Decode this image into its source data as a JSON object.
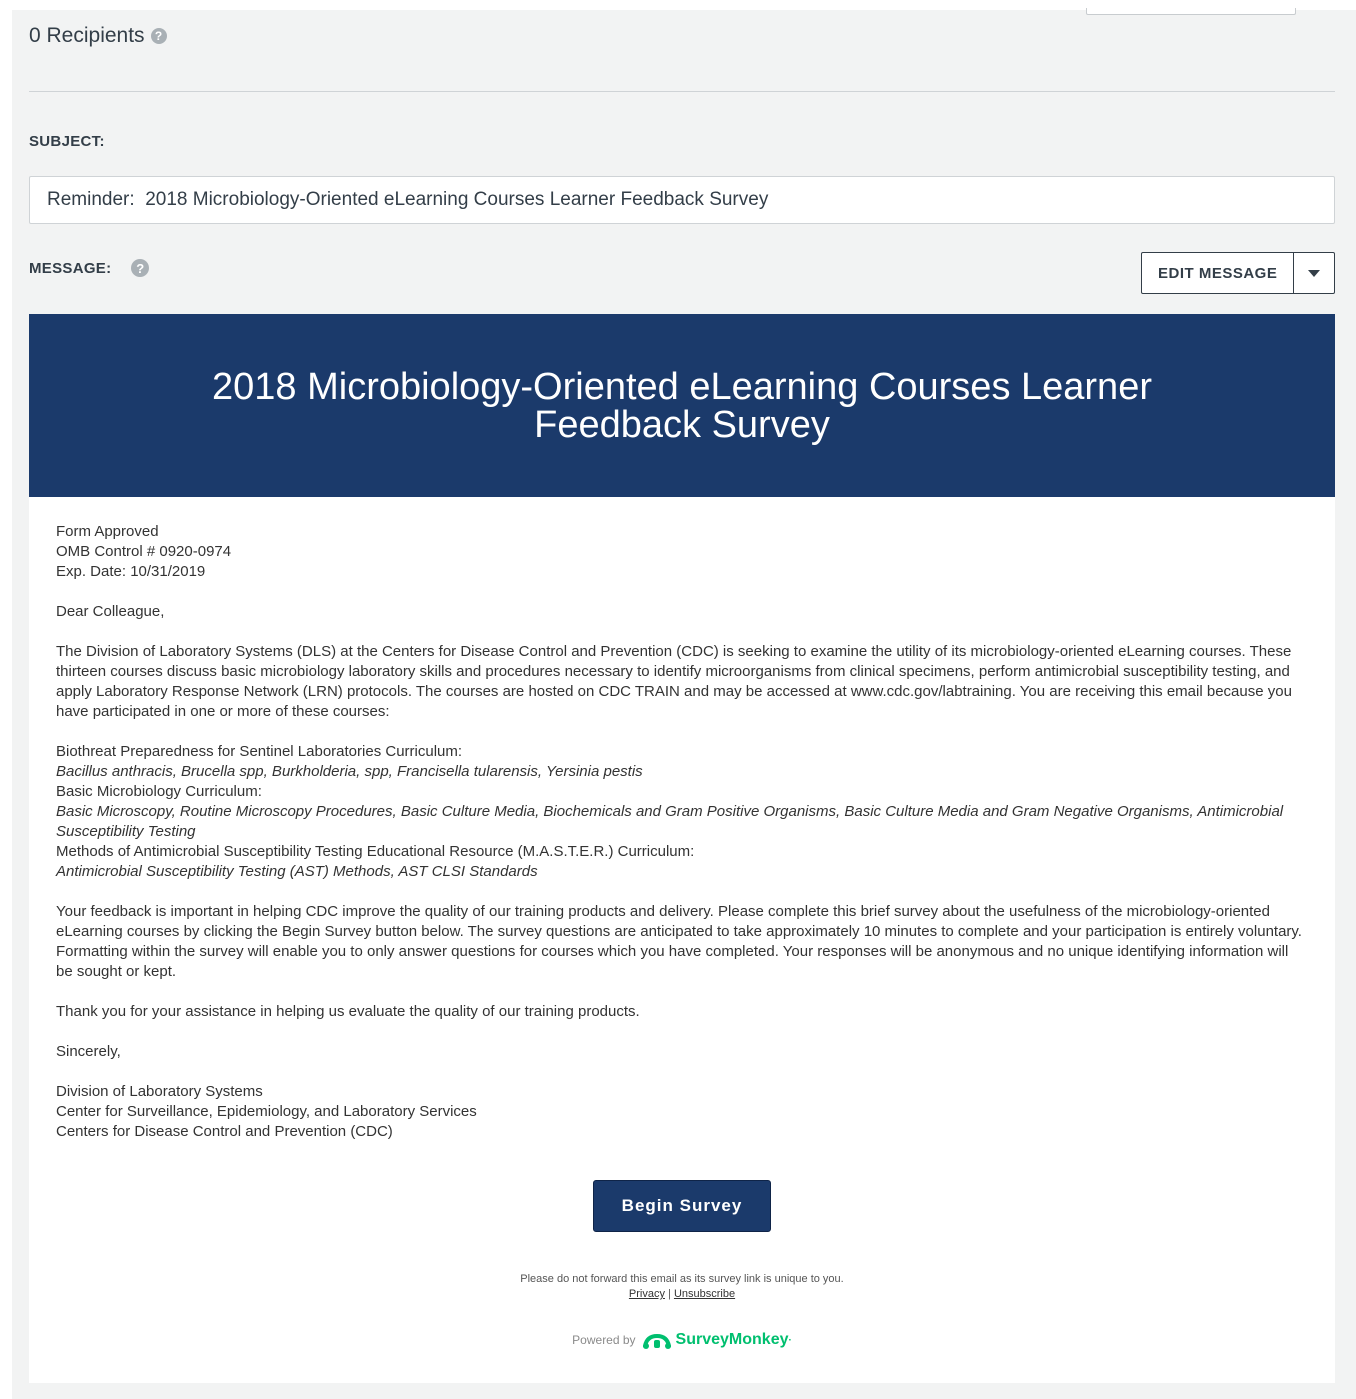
{
  "recipients": {
    "label": "0 Recipients",
    "help_icon": "?"
  },
  "subject": {
    "label": "SUBJECT:",
    "value": "Reminder:  2018 Microbiology-Oriented eLearning Courses Learner Feedback Survey"
  },
  "message": {
    "label": "MESSAGE:",
    "help_icon": "?",
    "edit_button": "EDIT MESSAGE"
  },
  "email": {
    "banner_title": "2018 Microbiology-Oriented eLearning Courses Learner Feedback Survey",
    "form_approved": "Form Approved",
    "omb_control": "OMB Control # 0920-0974",
    "exp_date": "Exp. Date: 10/31/2019",
    "greeting": "Dear Colleague,",
    "intro": "The Division of Laboratory Systems (DLS) at the Centers for Disease Control and Prevention (CDC) is seeking to examine the utility of its microbiology-oriented eLearning courses. These thirteen courses discuss basic microbiology laboratory skills and procedures necessary to identify microorganisms from clinical specimens, perform antimicrobial susceptibility testing, and apply Laboratory Response Network (LRN) protocols. The courses are hosted on CDC TRAIN and may be accessed at www.cdc.gov/labtraining. You are receiving this email because you have participated in one or more of these courses:",
    "curricula": [
      {
        "name": "Biothreat Preparedness for Sentinel Laboratories Curriculum:",
        "courses": "Bacillus anthracis, Brucella spp, Burkholderia, spp, Francisella tularensis, Yersinia pestis"
      },
      {
        "name": "Basic Microbiology Curriculum:",
        "courses": "Basic Microscopy, Routine Microscopy Procedures, Basic Culture Media, Biochemicals and Gram Positive Organisms, Basic Culture Media and Gram Negative Organisms, Antimicrobial Susceptibility Testing"
      },
      {
        "name": "Methods of Antimicrobial Susceptibility Testing Educational Resource (M.A.S.T.E.R.) Curriculum:",
        "courses": "Antimicrobial Susceptibility Testing (AST) Methods, AST CLSI Standards"
      }
    ],
    "feedback": "Your feedback is important in helping CDC improve the quality of our training products and delivery. Please complete this brief survey about the usefulness of the microbiology-oriented eLearning courses by clicking the Begin Survey button below. The survey questions are anticipated to take approximately 10 minutes to complete and your participation is entirely voluntary. Formatting within the survey will enable you to only answer questions for courses which you have completed. Your responses will be anonymous and no unique identifying information will be sought or kept.",
    "thanks": "Thank you for your assistance in helping us evaluate the quality of our training products.",
    "closing": "Sincerely,",
    "signature": [
      "Division of Laboratory Systems",
      "Center for Surveillance, Epidemiology, and Laboratory Services",
      "Centers for Disease Control and Prevention (CDC)"
    ],
    "begin_button": "Begin Survey",
    "forward_note": "Please do not forward this email as its survey link is unique to you.",
    "privacy_link": "Privacy",
    "separator": "|",
    "unsubscribe_link": "Unsubscribe",
    "powered_by": "Powered by",
    "brand": "SurveyMonkey",
    "brand_mark": "·",
    "brand_color": "#00bf6f",
    "banner_color": "#1b3a6b"
  }
}
